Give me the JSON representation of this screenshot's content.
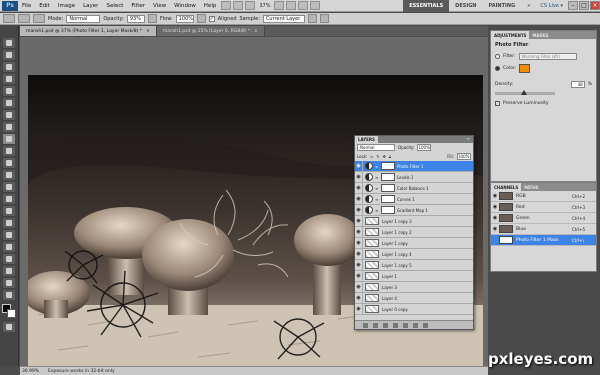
{
  "menubar": {
    "logo": "Ps",
    "items": [
      "File",
      "Edit",
      "Image",
      "Layer",
      "Select",
      "Filter",
      "View",
      "Window",
      "Help"
    ],
    "zoom": "37%",
    "workspaces": [
      "ESSENTIALS",
      "DESIGN",
      "PAINTING",
      "»"
    ],
    "active_workspace": "ESSENTIALS",
    "cslive": "CS Live ▾",
    "window_controls": [
      "–",
      "□",
      "×"
    ]
  },
  "options": {
    "mode_label": "Mode:",
    "mode_value": "Normal",
    "opacity_label": "Opacity:",
    "opacity_value": "93%",
    "flow_label": "Flow:",
    "flow_value": "100%",
    "aligned_label": "Aligned",
    "sample_label": "Sample:",
    "sample_value": "Current Layer"
  },
  "tabs": [
    {
      "label": "mansh1.psd @ 37% (Photo Filter 1, Layer Mask/8) *",
      "active": true
    },
    {
      "label": "mansh1.psd @ 25% (Layer 0, RGB/8) *",
      "active": false
    }
  ],
  "status": {
    "zoom": "36.99%",
    "message": "Exposure works in 32-bit only"
  },
  "adjustments": {
    "tabs": [
      "ADJUSTMENTS",
      "MASKS"
    ],
    "title": "Photo Filter",
    "filter_label": "Filter:",
    "filter_value": "Warming Filter (85)",
    "color_label": "Color:",
    "color_hex": "#f08c00",
    "density_label": "Density:",
    "density_value": "48",
    "density_unit": "%",
    "density_fraction": 0.48,
    "preserve_label": "Preserve Luminosity"
  },
  "channels": {
    "tabs": [
      "CHANNELS",
      "PATHS"
    ],
    "rows": [
      {
        "name": "RGB",
        "key": "Ctrl+2"
      },
      {
        "name": "Red",
        "key": "Ctrl+3"
      },
      {
        "name": "Green",
        "key": "Ctrl+4"
      },
      {
        "name": "Blue",
        "key": "Ctrl+5"
      },
      {
        "name": "Photo Filter 1 Mask",
        "key": "Ctrl+\\"
      }
    ]
  },
  "layers": {
    "tab": "LAYERS",
    "blend": "Normal",
    "opacity_label": "Opacity:",
    "opacity_value": "100%",
    "lock_label": "Lock:",
    "fill_label": "Fill:",
    "fill_value": "100%",
    "rows": [
      {
        "name": "Photo Filter 1",
        "type": "adj",
        "selected": true
      },
      {
        "name": "Levels 1",
        "type": "adj"
      },
      {
        "name": "Color Balance 1",
        "type": "adj"
      },
      {
        "name": "Curves 1",
        "type": "adj"
      },
      {
        "name": "Gradient Map 1",
        "type": "adj"
      },
      {
        "name": "Layer 1 copy 3",
        "type": "px"
      },
      {
        "name": "Layer 1 copy 2",
        "type": "px"
      },
      {
        "name": "Layer 1 copy",
        "type": "px"
      },
      {
        "name": "Layer 1 copy 4",
        "type": "px"
      },
      {
        "name": "Layer 1 copy 5",
        "type": "px"
      },
      {
        "name": "Layer 1",
        "type": "px"
      },
      {
        "name": "Layer 3",
        "type": "px"
      },
      {
        "name": "Layer 4",
        "type": "px"
      },
      {
        "name": "Layer 0 copy",
        "type": "px"
      }
    ]
  },
  "watermark": "pxleyes.com"
}
